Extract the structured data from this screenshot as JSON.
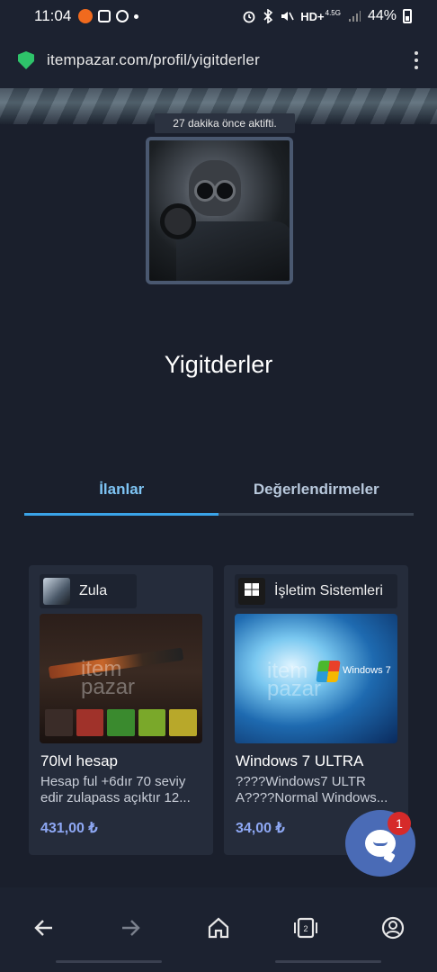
{
  "status_bar": {
    "time": "11:04",
    "network": "HD+",
    "network_sub": "4.5G",
    "battery": "44%"
  },
  "browser": {
    "url": "itempazar.com/profil/yigitderler"
  },
  "profile": {
    "last_active": "27 dakika önce aktifti.",
    "username": "Yigitderler"
  },
  "tabs": [
    {
      "label": "İlanlar",
      "active": true
    },
    {
      "label": "Değerlendirmeler",
      "active": false
    }
  ],
  "listings": [
    {
      "category": "Zula",
      "title": "70lvl hesap",
      "description": "Hesap ful +6dır 70 seviy edir zulapass açıktır 12...",
      "price": "431,00 ₺",
      "watermark": "item pazar"
    },
    {
      "category": "İşletim Sistemleri",
      "title": "Windows 7 ULTRA",
      "description": "????Windows7 ULTR A????Normal Windows...",
      "price": "34,00 ₺",
      "image_text": "Windows 7",
      "watermark": "item pazar"
    }
  ],
  "chat": {
    "badge_count": "1"
  },
  "colors": {
    "background": "#1a1f2c",
    "tab_active": "#7ec4f4",
    "price": "#8ea8f4",
    "chat": "#4a6bb6",
    "badge": "#d62a2a",
    "secure": "#2ec36a"
  }
}
